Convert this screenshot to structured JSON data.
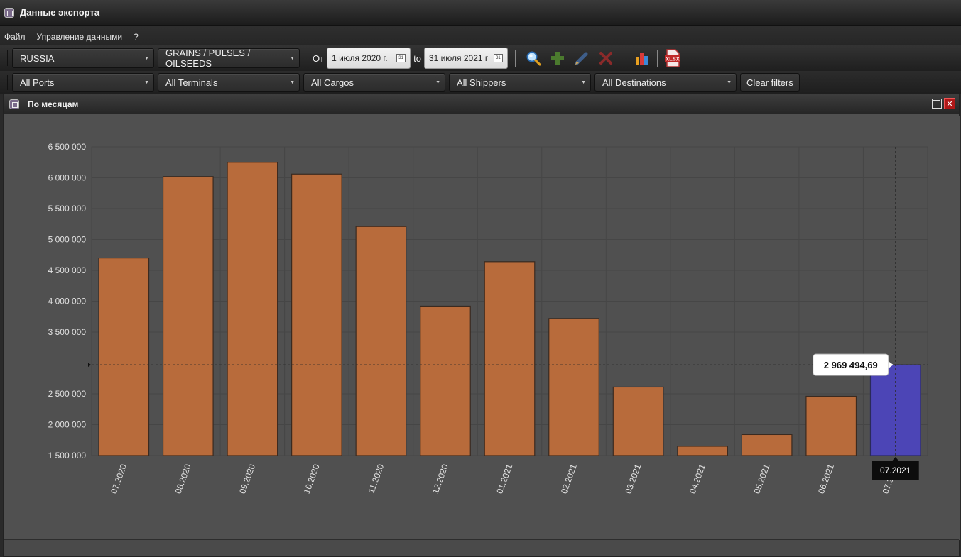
{
  "window": {
    "title": "Данные экспорта"
  },
  "menu": {
    "items": [
      "Файл",
      "Управление данными",
      "?"
    ]
  },
  "toolbar": {
    "country": "RUSSIA",
    "commodity": "GRAINS / PULSES / OILSEEDS",
    "from_label": "От",
    "date_from": "1 июля 2020 г.",
    "to_label": "to",
    "date_to": "31 июля 2021 г",
    "calendar_glyph": "31"
  },
  "filters": {
    "ports": "All Ports",
    "terminals": "All Terminals",
    "cargos": "All Cargos",
    "shippers": "All Shippers",
    "destinations": "All Destinations",
    "clear_label": "Clear filters"
  },
  "panel": {
    "title": "По месяцам",
    "close_glyph": "✕"
  },
  "colors": {
    "bar": "#b86b3b",
    "bar_selected": "#4c45b6",
    "grid": "#464646"
  },
  "icons": [
    "app-icon",
    "search-icon",
    "add-icon",
    "edit-icon",
    "delete-icon",
    "bar-chart-icon",
    "xlsx-export-icon"
  ],
  "chart_data": {
    "type": "bar",
    "categories": [
      "07.2020",
      "08.2020",
      "09.2020",
      "10.2020",
      "11.2020",
      "12.2020",
      "01.2021",
      "02.2021",
      "03.2021",
      "04.2021",
      "05.2021",
      "06.2021",
      "07.2021"
    ],
    "values": [
      4700000,
      6020000,
      6250000,
      6060000,
      5210000,
      3920000,
      4640000,
      3720000,
      2610000,
      1650000,
      1840000,
      2460000,
      2969494.69
    ],
    "selected_index": 12,
    "tooltip": "2 969 494,69",
    "category_tooltip": "07.2021",
    "yticks": [
      1500000,
      2000000,
      2500000,
      3500000,
      4000000,
      4500000,
      5000000,
      5500000,
      6000000,
      6500000
    ],
    "ytick_labels": [
      "1 500 000",
      "2 000 000",
      "2 500 000",
      "3 500 000",
      "4 000 000",
      "4 500 000",
      "5 000 000",
      "5 500 000",
      "6 000 000",
      "6 500 000"
    ],
    "ylim": [
      1500000,
      6500000
    ],
    "grid": true,
    "legend": "none",
    "title": "",
    "xlabel": "",
    "ylabel": ""
  }
}
